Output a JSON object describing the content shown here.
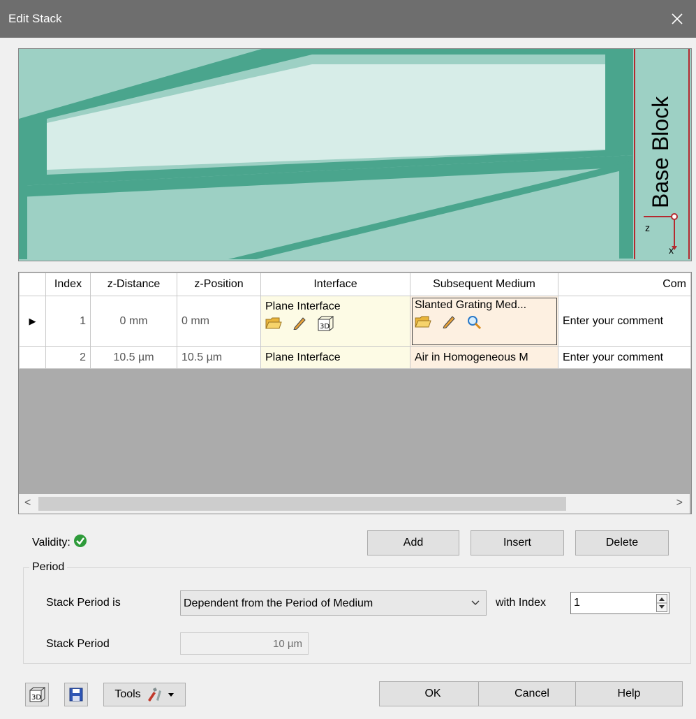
{
  "window": {
    "title": "Edit Stack",
    "close_glyph": "✕"
  },
  "preview": {
    "base_block_label": "Base Block",
    "axis_z": "z",
    "axis_x": "x",
    "colors": {
      "medium": "#9dd0c4",
      "grating": "#4aa58d",
      "inner": "#d7ede8",
      "frame": "#b5292f"
    }
  },
  "table": {
    "columns": [
      "",
      "Index",
      "z-Distance",
      "z-Position",
      "Interface",
      "Subsequent Medium",
      "Com"
    ],
    "rows": [
      {
        "index": "1",
        "z_distance": "0 mm",
        "z_position": "0 mm",
        "interface": "Plane Interface",
        "medium": "Slanted Grating Med...",
        "comment": "Enter your comment",
        "current_marker": "▶"
      },
      {
        "index": "2",
        "z_distance": "10.5 µm",
        "z_position": "10.5 µm",
        "interface": "Plane Interface",
        "medium": "Air in Homogeneous M",
        "comment": "Enter your comment"
      }
    ],
    "scroll_left": "<",
    "scroll_right": ">"
  },
  "validity": {
    "label": "Validity:",
    "status_icon": "check-circle-icon",
    "status_color": "#2e9b3a"
  },
  "buttons": {
    "add": "Add",
    "insert": "Insert",
    "delete": "Delete",
    "ok": "OK",
    "cancel": "Cancel",
    "help": "Help",
    "tools": "Tools"
  },
  "period": {
    "group_label": "Period",
    "stack_period_is_label": "Stack Period is",
    "stack_period_is_value": "Dependent from the Period of Medium",
    "with_index_label": "with Index",
    "with_index_value": "1",
    "stack_period_label": "Stack Period",
    "stack_period_value": "10 µm"
  }
}
